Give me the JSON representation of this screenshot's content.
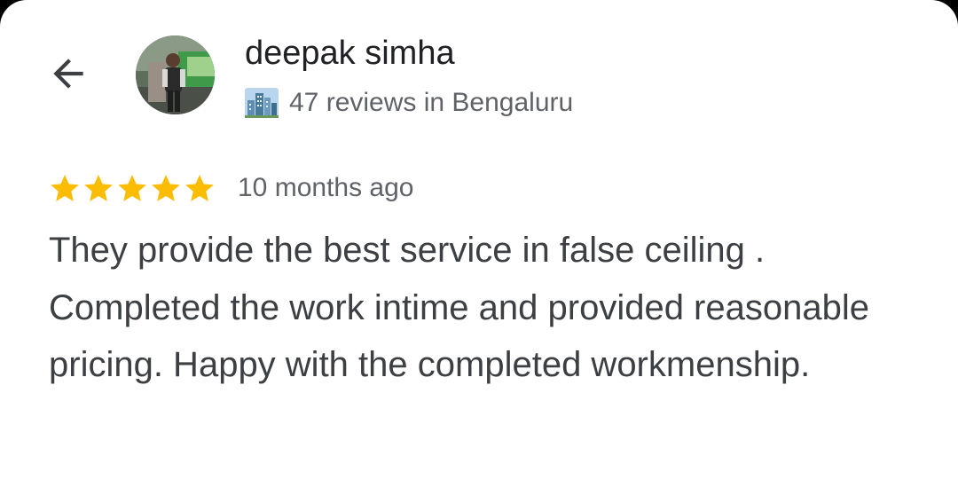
{
  "reviewer": {
    "name": "deepak simha",
    "meta": "47 reviews in Bengaluru",
    "meta_icon": "cityscape-icon"
  },
  "nav": {
    "back_icon": "arrow-left-icon"
  },
  "review": {
    "rating": 5,
    "rating_max": 5,
    "time_ago": "10 months ago",
    "text": "They provide the best service in false ceiling . Completed the work intime and provided reasonable pricing. Happy with the completed workmenship."
  },
  "colors": {
    "star": "#fbbc04",
    "name": "#202124",
    "secondary": "#5f6368",
    "body_text": "#3c4043",
    "background": "#ffffff"
  }
}
